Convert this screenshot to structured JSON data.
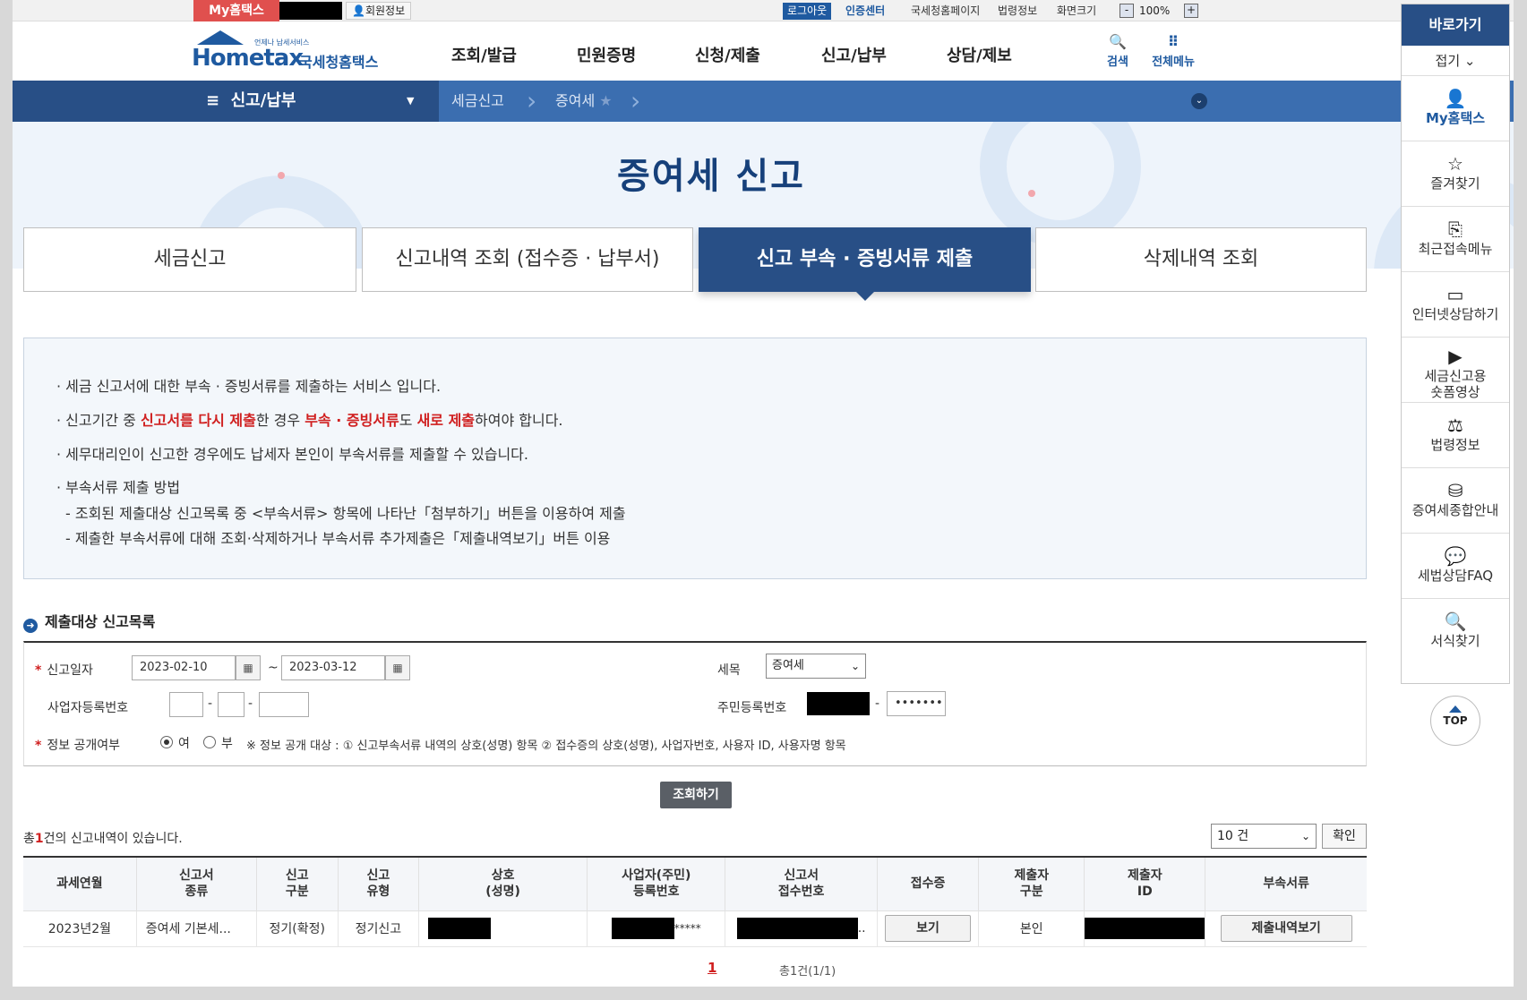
{
  "util": {
    "my_hometax": "My홈택스",
    "member_info": "회원정보",
    "logout": "로그아웃",
    "cert_center": "인증센터",
    "nts_page": "국세청홈페이지",
    "law_info": "법령정보",
    "screen_size": "화면크기",
    "zoom_minus": "-",
    "zoom_value": "100%",
    "zoom_plus": "+"
  },
  "logo": {
    "tagline": "언제나 납세서비스",
    "name": "Hometax",
    "korean": "국세청홈택스"
  },
  "gnb": [
    "조회/발급",
    "민원증명",
    "신청/제출",
    "신고/납부",
    "상담/제보"
  ],
  "header_icons": {
    "search": "검색",
    "all_menu": "전체메뉴"
  },
  "breadcrumb": {
    "menu": "신고/납부",
    "item1": "세금신고",
    "item2": "증여세"
  },
  "page_title": "증여세 신고",
  "tabs": [
    {
      "label": "세금신고"
    },
    {
      "label": "신고내역 조회 (접수증 · 납부서)"
    },
    {
      "label": "신고 부속 · 증빙서류 제출"
    },
    {
      "label": "삭제내역 조회"
    }
  ],
  "info": {
    "line1": "· 세금 신고서에 대한 부속 · 증빙서류를 제출하는 서비스 입니다.",
    "line2_a": "· 신고기간 중 ",
    "line2_b": "신고서를 다시 제출",
    "line2_c": "한 경우 ",
    "line2_d": "부속 · 증빙서류",
    "line2_e": "도 ",
    "line2_f": "새로 제출",
    "line2_g": "하여야 합니다.",
    "line3": "· 세무대리인이 신고한 경우에도 납세자 본인이 부속서류를 제출할 수 있습니다.",
    "line4": "· 부속서류 제출 방법",
    "line5": "- 조회된 제출대상 신고목록 중 <부속서류> 항목에 나타난「첨부하기」버튼을 이용하여 제출",
    "line6": "- 제출한 부속서류에 대해 조회·삭제하거나 부속서류 추가제출은「제출내역보기」버튼 이용"
  },
  "section_title": "제출대상 신고목록",
  "form": {
    "date_label": "신고일자",
    "date_from": "2023-02-10",
    "date_sep": "~",
    "date_to": "2023-03-12",
    "tax_label": "세목",
    "tax_value": "증여세",
    "biz_label": "사업자등록번호",
    "rrn_label": "주민등록번호",
    "rrn_masked": "•••••••",
    "dash": "-",
    "disclose_label": "정보 공개여부",
    "opt_yes": "여",
    "opt_no": "부",
    "disclose_note": "※ 정보 공개 대상 : ① 신고부속서류 내역의 상호(성명) 항목 ② 접수증의 상호(성명), 사업자번호, 사용자 ID, 사용자명 항목"
  },
  "search_button": "조회하기",
  "count": {
    "pre": "총",
    "num": "1",
    "post": "건의 신고내역이 있습니다."
  },
  "page_size": "10 건",
  "confirm": "확인",
  "table": {
    "headers": [
      "과세연월",
      "신고서\n종류",
      "신고\n구분",
      "신고\n유형",
      "상호\n(성명)",
      "사업자(주민)\n등록번호",
      "신고서\n접수번호",
      "접수증",
      "제출자\n구분",
      "제출자\nID",
      "부속서류"
    ],
    "row": {
      "period": "2023년2월",
      "form_type": "증여세 기본세...",
      "category": "정기(확정)",
      "type": "정기신고",
      "id_suffix": "*****",
      "receipt_suffix": "..",
      "view_btn": "보기",
      "submitter": "본인",
      "history_btn": "제출내역보기"
    }
  },
  "pager": {
    "current": "1",
    "info": "총1건(1/1)"
  },
  "quick": {
    "title": "바로가기",
    "fold": "접기 ⌄",
    "items": [
      "My홈택스",
      "즐겨찾기",
      "최근접속메뉴",
      "인터넷상담하기",
      "세금신고용\n숏폼영상",
      "법령정보",
      "증여세종합안내",
      "세법상담FAQ",
      "서식찾기"
    ],
    "top": "TOP"
  },
  "colors": {
    "primary": "#284f86",
    "accent_red": "#d02020",
    "brand_blue": "#1f5aa0"
  }
}
